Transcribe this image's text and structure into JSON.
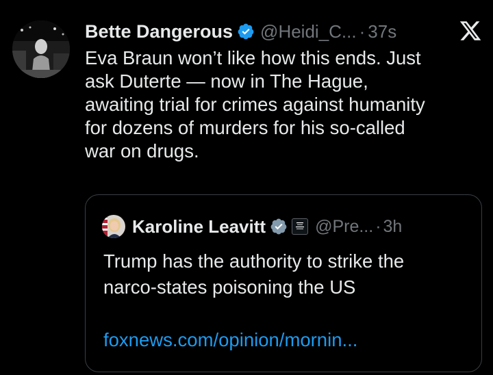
{
  "tweet": {
    "author_name": "Bette Dangerous",
    "handle": "@Heidi_C...",
    "separator": "·",
    "timestamp": "37s",
    "lines": [
      "Eva Braun won’t like how this ends. Just",
      "ask Duterte — now in The Hague,",
      "awaiting trial for crimes against humanity",
      "for dozens of murders for his so-called",
      "war on drugs."
    ]
  },
  "quote": {
    "author_name": "Karoline Leavitt",
    "affiliation_badge": "THE WHITE HOUSE",
    "handle": "@Pre...",
    "separator": "·",
    "timestamp": "3h",
    "lines": [
      "Trump has the authority to strike the",
      "narco-states poisoning the US"
    ],
    "link": "foxnews.com/opinion/mornin..."
  },
  "icons": {
    "verified": "verified-badge-icon",
    "platform": "x-logo-icon",
    "affiliation": "white-house-badge-icon"
  },
  "colors": {
    "background": "#000000",
    "text": "#e7e9ea",
    "muted": "#71767b",
    "accent": "#1d9bf0",
    "border": "#3a3f44"
  }
}
